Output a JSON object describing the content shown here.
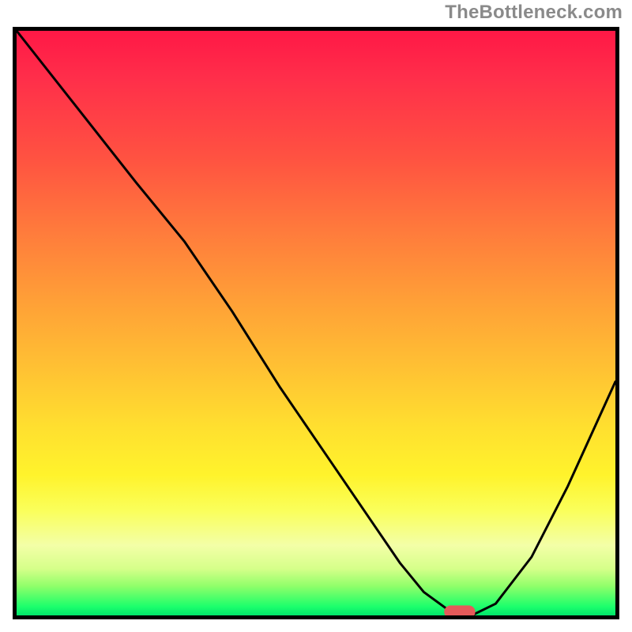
{
  "watermark": "TheBottleneck.com",
  "colors": {
    "gradient_top": "#ff1846",
    "gradient_bottom": "#00e56b",
    "curve": "#000000",
    "marker": "#e55a5a",
    "frame": "#000000"
  },
  "chart_data": {
    "type": "line",
    "title": "",
    "xlabel": "",
    "ylabel": "",
    "xlim": [
      0,
      100
    ],
    "ylim": [
      0,
      100
    ],
    "x": [
      0,
      10,
      20,
      28,
      36,
      44,
      52,
      58,
      64,
      68,
      72,
      76,
      80,
      86,
      92,
      100
    ],
    "values": [
      100,
      87,
      74,
      64,
      52,
      39,
      27,
      18,
      9,
      4,
      1,
      0,
      2,
      10,
      22,
      40
    ],
    "marker": {
      "x": 74,
      "y": 0
    },
    "notes": "Axes have no numeric tick labels; values above are estimated from curve geometry on a 0–100 scale in each axis. Y=0 is the bottom edge (green), Y=100 is the top edge (red)."
  }
}
